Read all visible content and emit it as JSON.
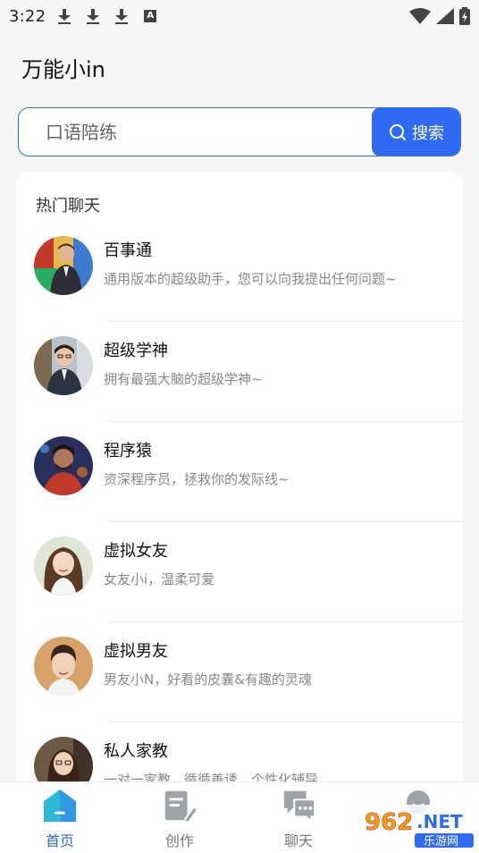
{
  "status_bar": {
    "time": "3:22",
    "icons": [
      "download-icon",
      "download-icon",
      "download-icon",
      "font-a-icon",
      "wifi-icon",
      "signal-icon",
      "battery-icon"
    ]
  },
  "app": {
    "title": "万能小in"
  },
  "search": {
    "placeholder": "口语陪练",
    "button_label": "搜索"
  },
  "hot_chats": {
    "title": "热门聊天",
    "items": [
      {
        "name": "百事通",
        "desc": "通用版本的超级助手，您可以向我提出任何问题~"
      },
      {
        "name": "超级学神",
        "desc": "拥有最强大脑的超级学神~"
      },
      {
        "name": "程序猿",
        "desc": "资深程序员，拯救你的发际线~"
      },
      {
        "name": "虚拟女友",
        "desc": "女友小i，温柔可爱"
      },
      {
        "name": "虚拟男友",
        "desc": "男友小N，好看的皮囊&有趣的灵魂"
      },
      {
        "name": "私人家教",
        "desc": "一对一家教，循循善诱，个性化辅导"
      }
    ]
  },
  "bottom_nav": {
    "tabs": [
      {
        "label": "首页",
        "icon": "home-icon",
        "active": true
      },
      {
        "label": "创作",
        "icon": "edit-document-icon",
        "active": false
      },
      {
        "label": "聊天",
        "icon": "chat-bubbles-icon",
        "active": false
      },
      {
        "label": "",
        "icon": "profile-icon",
        "active": false
      }
    ]
  },
  "watermark": {
    "text": "962.NET",
    "subtext": "乐游网"
  },
  "colors": {
    "accent": "#2f6bf2",
    "background": "#f6f6f7",
    "card": "#ffffff"
  }
}
